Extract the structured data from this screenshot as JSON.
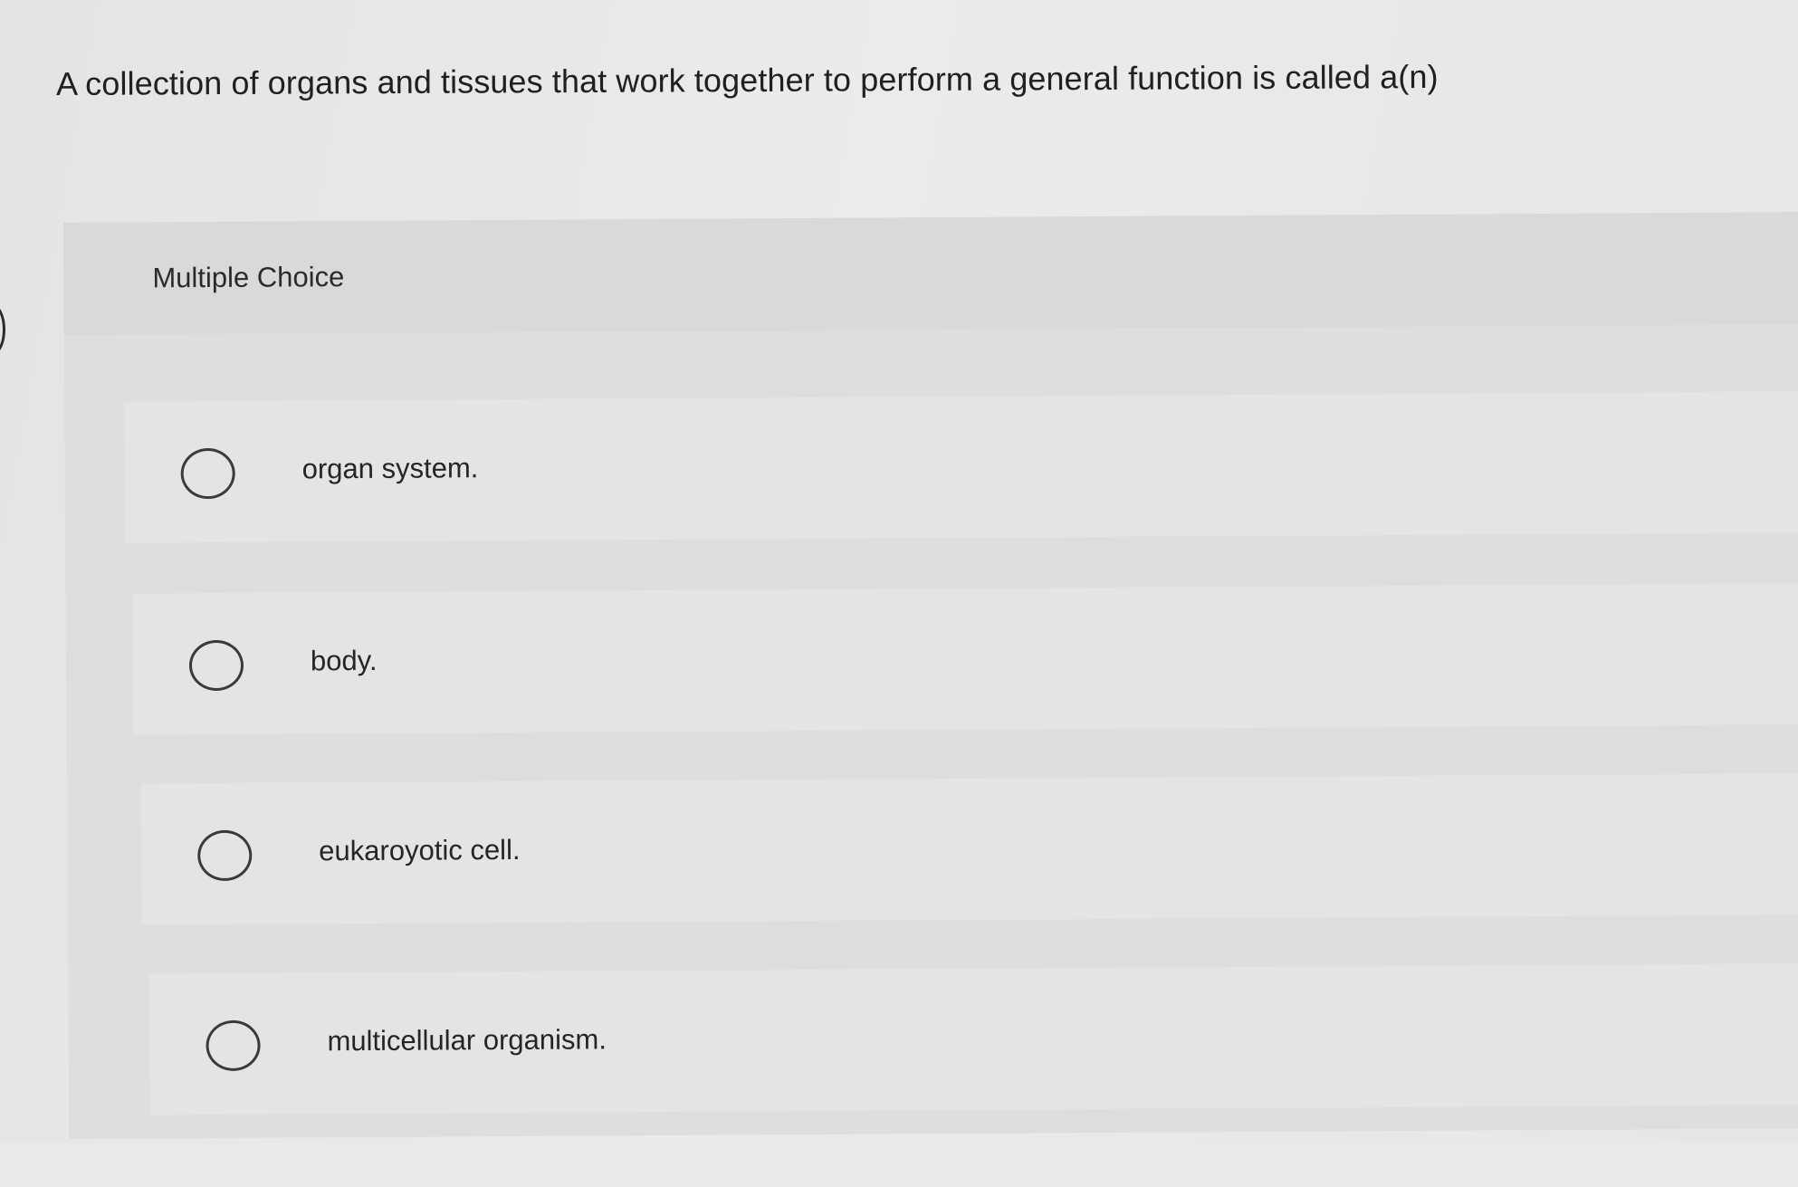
{
  "question": {
    "text": "A collection of organs and tissues that work together to perform a general function is called a(n)"
  },
  "multiple_choice": {
    "label": "Multiple Choice",
    "options": [
      {
        "label": "organ system.",
        "selected": false
      },
      {
        "label": "body.",
        "selected": false
      },
      {
        "label": "eukaroyotic cell.",
        "selected": false
      },
      {
        "label": "multicellular organism.",
        "selected": false
      }
    ]
  }
}
